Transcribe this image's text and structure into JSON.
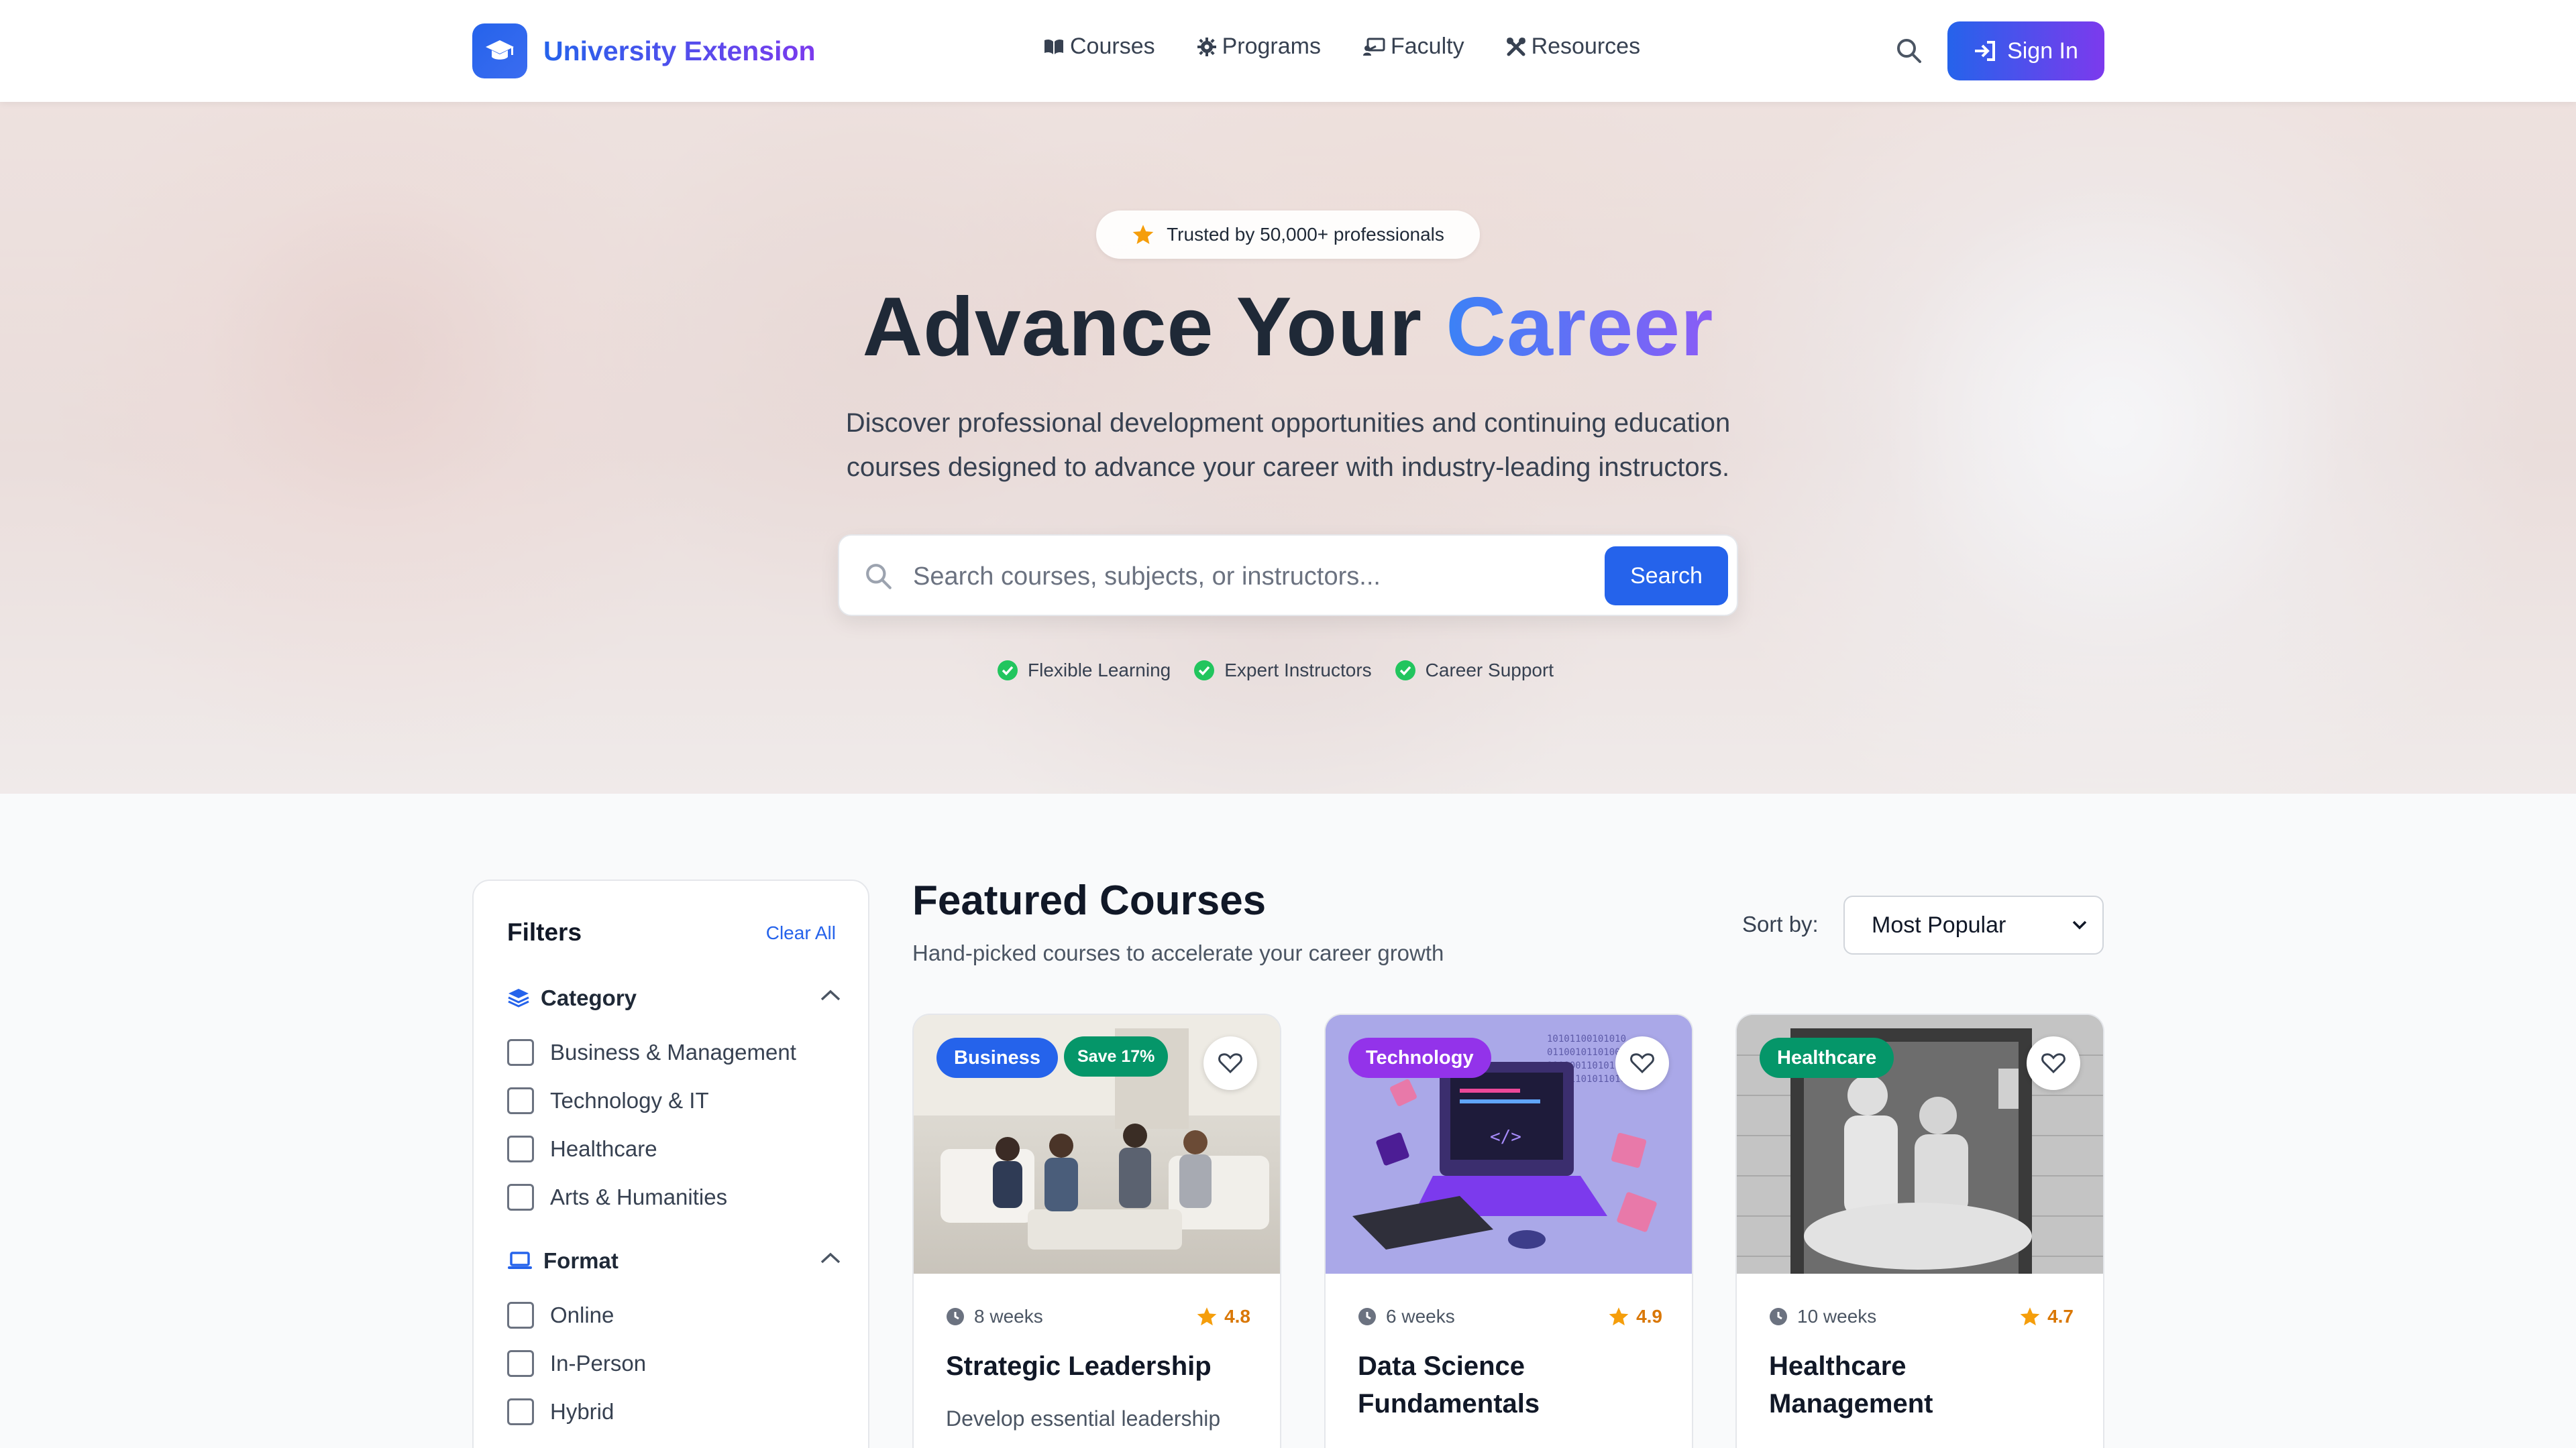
{
  "brand": {
    "name": "University Extension",
    "logo_icon": "graduation-cap-icon"
  },
  "nav": {
    "links": [
      {
        "label": "Courses",
        "icon": "book-open-icon"
      },
      {
        "label": "Programs",
        "icon": "gear-icon"
      },
      {
        "label": "Faculty",
        "icon": "chalkboard-teacher-icon"
      },
      {
        "label": "Resources",
        "icon": "tools-icon"
      }
    ],
    "signin_label": "Sign In"
  },
  "hero": {
    "trust_badge": "Trusted by 50,000+ professionals",
    "title_main": "Advance Your",
    "title_accent": "Career",
    "subtitle_line1": "Discover professional development opportunities and continuing education",
    "subtitle_line2": "courses designed to advance your career with industry-leading instructors.",
    "search_placeholder": "Search courses, subjects, or instructors...",
    "search_button": "Search",
    "features": [
      "Flexible Learning",
      "Expert Instructors",
      "Career Support"
    ]
  },
  "filters": {
    "title": "Filters",
    "clear_label": "Clear All",
    "category": {
      "label": "Category",
      "options": [
        "Business & Management",
        "Technology & IT",
        "Healthcare",
        "Arts & Humanities"
      ]
    },
    "format": {
      "label": "Format",
      "options": [
        "Online",
        "In-Person",
        "Hybrid"
      ]
    }
  },
  "main": {
    "title": "Featured Courses",
    "subtitle": "Hand-picked courses to accelerate your career growth",
    "sort_label": "Sort by:",
    "sort_value": "Most Popular"
  },
  "courses": [
    {
      "tag": "Business",
      "tag_color": "#2563eb",
      "save_badge": "Save 17%",
      "duration": "8 weeks",
      "rating": "4.8",
      "title": "Strategic Leadership",
      "description": "Develop essential leadership"
    },
    {
      "tag": "Technology",
      "tag_color": "#9333ea",
      "duration": "6 weeks",
      "rating": "4.9",
      "title": "Data Science Fundamentals",
      "description": ""
    },
    {
      "tag": "Healthcare",
      "tag_color": "#059669",
      "duration": "10 weeks",
      "rating": "4.7",
      "title": "Healthcare Management",
      "description": ""
    }
  ],
  "colors": {
    "primary": "#2563eb",
    "accent": "#7c3aed",
    "star": "#f59e0b",
    "check": "#22c55e"
  }
}
